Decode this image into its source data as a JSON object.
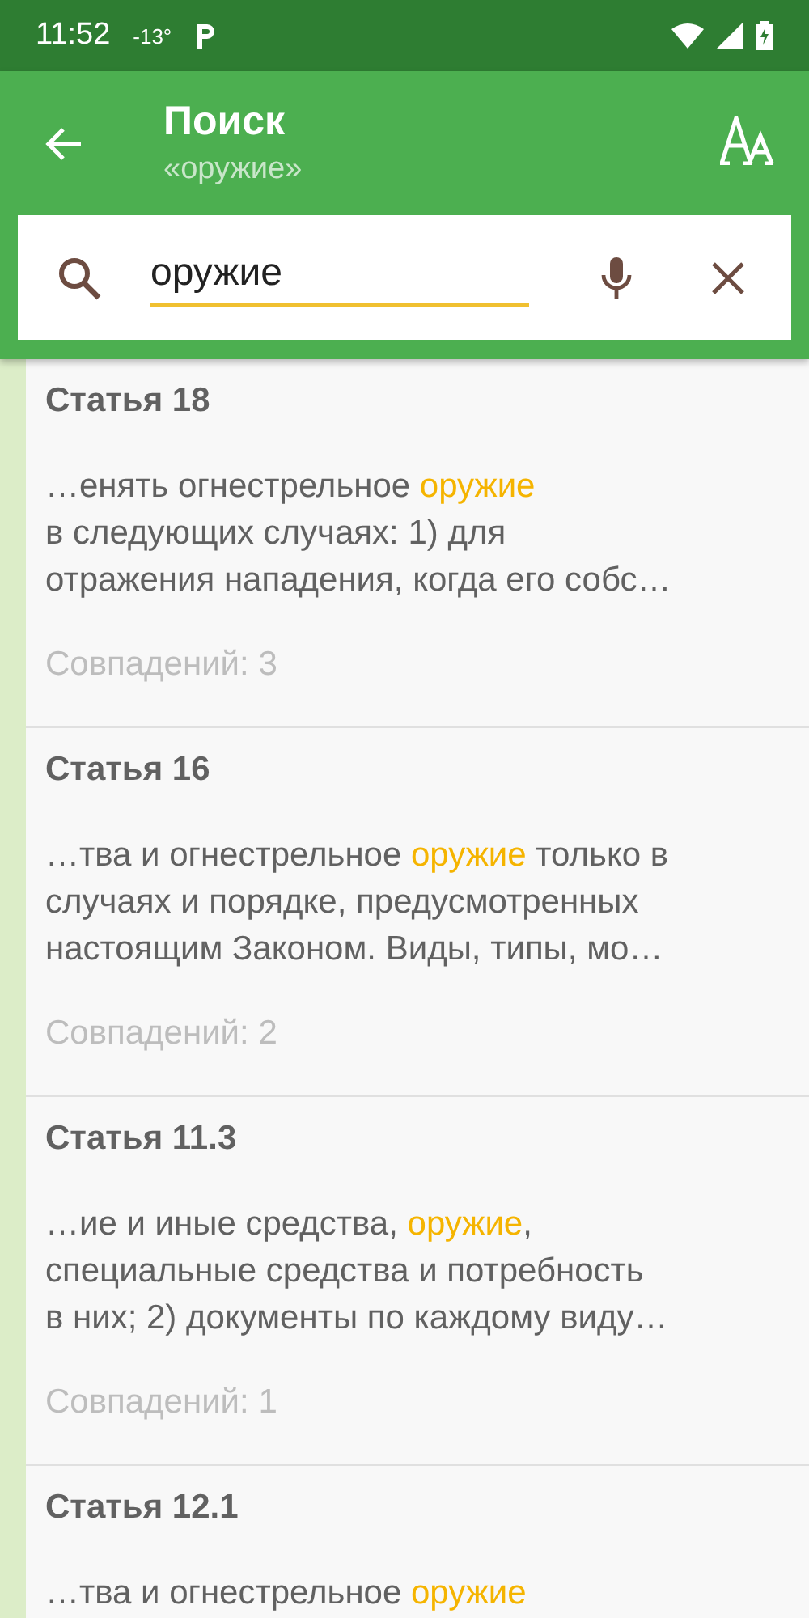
{
  "status_bar": {
    "time": "11:52",
    "temperature": "-13°"
  },
  "header": {
    "title": "Поиск",
    "subtitle": "«оружие»"
  },
  "search": {
    "value": "оружие"
  },
  "results": [
    {
      "title": "Статья 18",
      "snippet": [
        [
          {
            "text": "…енять огнестрельное ",
            "highlight": false
          },
          {
            "text": "оружие",
            "highlight": true
          }
        ],
        [
          {
            "text": "в следующих случаях: 1) для",
            "highlight": false
          }
        ],
        [
          {
            "text": "отражения нападения, когда его собс…",
            "highlight": false
          }
        ]
      ],
      "count": "Совпадений: 3"
    },
    {
      "title": "Статья 16",
      "snippet": [
        [
          {
            "text": "…тва и огнестрельное ",
            "highlight": false
          },
          {
            "text": "оружие",
            "highlight": true
          },
          {
            "text": " только в",
            "highlight": false
          }
        ],
        [
          {
            "text": "случаях и порядке, предусмотренных",
            "highlight": false
          }
        ],
        [
          {
            "text": "настоящим Законом. Виды, типы, мо…",
            "highlight": false
          }
        ]
      ],
      "count": "Совпадений: 2"
    },
    {
      "title": "Статья 11.3",
      "snippet": [
        [
          {
            "text": "…ие и иные средства, ",
            "highlight": false
          },
          {
            "text": "оружие",
            "highlight": true
          },
          {
            "text": ",",
            "highlight": false
          }
        ],
        [
          {
            "text": "специальные средства и потребность",
            "highlight": false
          }
        ],
        [
          {
            "text": "в них; 2) документы по каждому виду…",
            "highlight": false
          }
        ]
      ],
      "count": "Совпадений: 1"
    },
    {
      "title": "Статья 12.1",
      "snippet": [
        [
          {
            "text": "…тва и огнестрельное ",
            "highlight": false
          },
          {
            "text": "оружие",
            "highlight": true
          }
        ]
      ]
    }
  ]
}
